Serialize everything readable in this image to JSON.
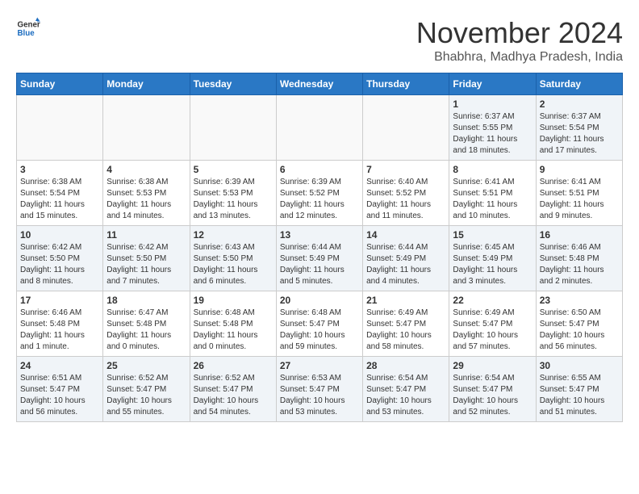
{
  "header": {
    "logo_general": "General",
    "logo_blue": "Blue",
    "month_title": "November 2024",
    "location": "Bhabhra, Madhya Pradesh, India"
  },
  "days_of_week": [
    "Sunday",
    "Monday",
    "Tuesday",
    "Wednesday",
    "Thursday",
    "Friday",
    "Saturday"
  ],
  "weeks": [
    [
      {
        "day": "",
        "info": ""
      },
      {
        "day": "",
        "info": ""
      },
      {
        "day": "",
        "info": ""
      },
      {
        "day": "",
        "info": ""
      },
      {
        "day": "",
        "info": ""
      },
      {
        "day": "1",
        "info": "Sunrise: 6:37 AM\nSunset: 5:55 PM\nDaylight: 11 hours and 18 minutes."
      },
      {
        "day": "2",
        "info": "Sunrise: 6:37 AM\nSunset: 5:54 PM\nDaylight: 11 hours and 17 minutes."
      }
    ],
    [
      {
        "day": "3",
        "info": "Sunrise: 6:38 AM\nSunset: 5:54 PM\nDaylight: 11 hours and 15 minutes."
      },
      {
        "day": "4",
        "info": "Sunrise: 6:38 AM\nSunset: 5:53 PM\nDaylight: 11 hours and 14 minutes."
      },
      {
        "day": "5",
        "info": "Sunrise: 6:39 AM\nSunset: 5:53 PM\nDaylight: 11 hours and 13 minutes."
      },
      {
        "day": "6",
        "info": "Sunrise: 6:39 AM\nSunset: 5:52 PM\nDaylight: 11 hours and 12 minutes."
      },
      {
        "day": "7",
        "info": "Sunrise: 6:40 AM\nSunset: 5:52 PM\nDaylight: 11 hours and 11 minutes."
      },
      {
        "day": "8",
        "info": "Sunrise: 6:41 AM\nSunset: 5:51 PM\nDaylight: 11 hours and 10 minutes."
      },
      {
        "day": "9",
        "info": "Sunrise: 6:41 AM\nSunset: 5:51 PM\nDaylight: 11 hours and 9 minutes."
      }
    ],
    [
      {
        "day": "10",
        "info": "Sunrise: 6:42 AM\nSunset: 5:50 PM\nDaylight: 11 hours and 8 minutes."
      },
      {
        "day": "11",
        "info": "Sunrise: 6:42 AM\nSunset: 5:50 PM\nDaylight: 11 hours and 7 minutes."
      },
      {
        "day": "12",
        "info": "Sunrise: 6:43 AM\nSunset: 5:50 PM\nDaylight: 11 hours and 6 minutes."
      },
      {
        "day": "13",
        "info": "Sunrise: 6:44 AM\nSunset: 5:49 PM\nDaylight: 11 hours and 5 minutes."
      },
      {
        "day": "14",
        "info": "Sunrise: 6:44 AM\nSunset: 5:49 PM\nDaylight: 11 hours and 4 minutes."
      },
      {
        "day": "15",
        "info": "Sunrise: 6:45 AM\nSunset: 5:49 PM\nDaylight: 11 hours and 3 minutes."
      },
      {
        "day": "16",
        "info": "Sunrise: 6:46 AM\nSunset: 5:48 PM\nDaylight: 11 hours and 2 minutes."
      }
    ],
    [
      {
        "day": "17",
        "info": "Sunrise: 6:46 AM\nSunset: 5:48 PM\nDaylight: 11 hours and 1 minute."
      },
      {
        "day": "18",
        "info": "Sunrise: 6:47 AM\nSunset: 5:48 PM\nDaylight: 11 hours and 0 minutes."
      },
      {
        "day": "19",
        "info": "Sunrise: 6:48 AM\nSunset: 5:48 PM\nDaylight: 11 hours and 0 minutes."
      },
      {
        "day": "20",
        "info": "Sunrise: 6:48 AM\nSunset: 5:47 PM\nDaylight: 10 hours and 59 minutes."
      },
      {
        "day": "21",
        "info": "Sunrise: 6:49 AM\nSunset: 5:47 PM\nDaylight: 10 hours and 58 minutes."
      },
      {
        "day": "22",
        "info": "Sunrise: 6:49 AM\nSunset: 5:47 PM\nDaylight: 10 hours and 57 minutes."
      },
      {
        "day": "23",
        "info": "Sunrise: 6:50 AM\nSunset: 5:47 PM\nDaylight: 10 hours and 56 minutes."
      }
    ],
    [
      {
        "day": "24",
        "info": "Sunrise: 6:51 AM\nSunset: 5:47 PM\nDaylight: 10 hours and 56 minutes."
      },
      {
        "day": "25",
        "info": "Sunrise: 6:52 AM\nSunset: 5:47 PM\nDaylight: 10 hours and 55 minutes."
      },
      {
        "day": "26",
        "info": "Sunrise: 6:52 AM\nSunset: 5:47 PM\nDaylight: 10 hours and 54 minutes."
      },
      {
        "day": "27",
        "info": "Sunrise: 6:53 AM\nSunset: 5:47 PM\nDaylight: 10 hours and 53 minutes."
      },
      {
        "day": "28",
        "info": "Sunrise: 6:54 AM\nSunset: 5:47 PM\nDaylight: 10 hours and 53 minutes."
      },
      {
        "day": "29",
        "info": "Sunrise: 6:54 AM\nSunset: 5:47 PM\nDaylight: 10 hours and 52 minutes."
      },
      {
        "day": "30",
        "info": "Sunrise: 6:55 AM\nSunset: 5:47 PM\nDaylight: 10 hours and 51 minutes."
      }
    ]
  ]
}
